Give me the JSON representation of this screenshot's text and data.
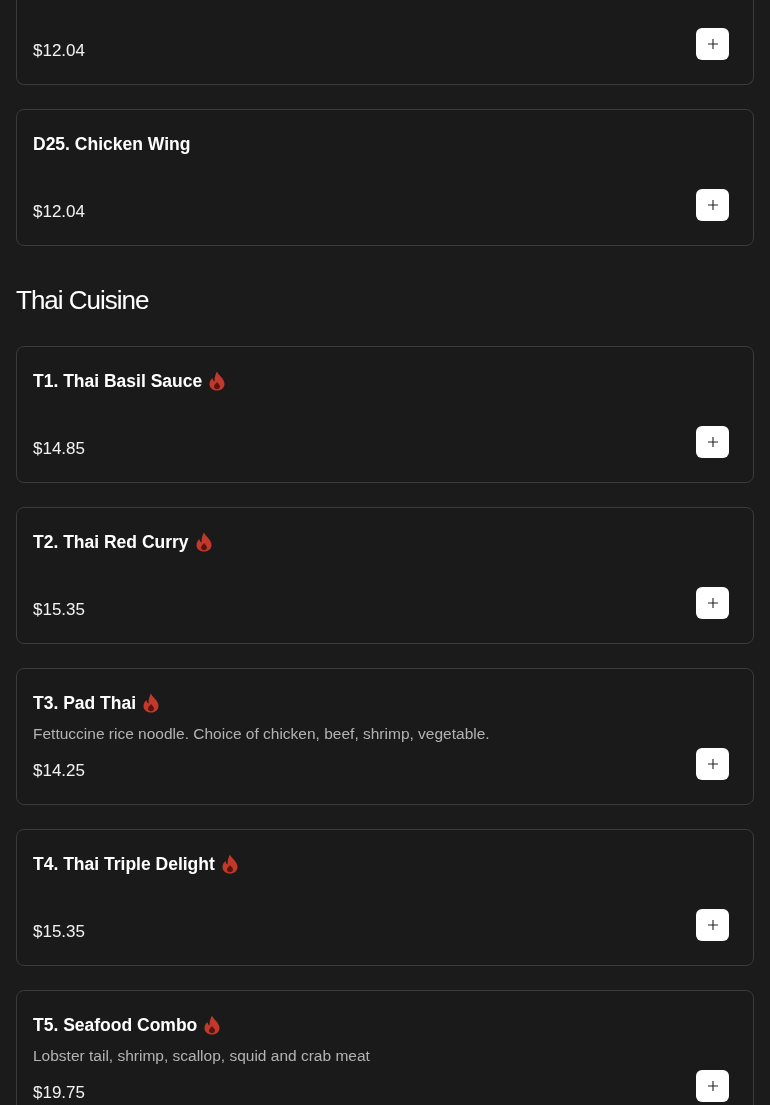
{
  "sections": [
    {
      "items": [
        {
          "price": "$12.04"
        },
        {
          "name": "D25. Chicken Wing",
          "spicy": false,
          "price": "$12.04"
        }
      ]
    },
    {
      "title": "Thai Cuisine",
      "items": [
        {
          "name": "T1. Thai Basil Sauce",
          "spicy": true,
          "price": "$14.85"
        },
        {
          "name": "T2. Thai Red Curry",
          "spicy": true,
          "price": "$15.35"
        },
        {
          "name": "T3. Pad Thai",
          "spicy": true,
          "description": "Fettuccine rice noodle. Choice of chicken, beef, shrimp, vegetable.",
          "price": "$14.25"
        },
        {
          "name": "T4. Thai Triple Delight",
          "spicy": true,
          "price": "$15.35"
        },
        {
          "name": "T5. Seafood Combo",
          "spicy": true,
          "description": "Lobster tail, shrimp, scallop, squid and crab meat",
          "price": "$19.75"
        }
      ]
    }
  ]
}
